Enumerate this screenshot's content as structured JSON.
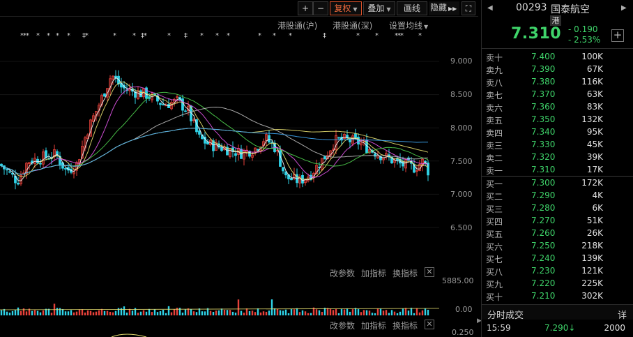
{
  "toolbar": {
    "plus": "+",
    "minus": "−",
    "fuquan": "复权",
    "diejia": "叠加",
    "huaxian": "画线",
    "yincang": "隐藏",
    "expand": "⛶"
  },
  "sub_toolbar": {
    "hk_connect_sh": "港股通(沪)",
    "hk_connect_sz": "港股通(深)",
    "ma_settings": "设置均线"
  },
  "main_axis": [
    "9.000",
    "8.500",
    "8.000",
    "7.500",
    "7.000",
    "6.500"
  ],
  "panel_links": {
    "change_params": "改参数",
    "add_indicator": "加指标",
    "swap_indicator": "换指标",
    "close": "✕"
  },
  "volume_axis": [
    "5885.00",
    "0.00"
  ],
  "lower_axis": [
    "0.250"
  ],
  "quote": {
    "code": "00293",
    "name": "国泰航空",
    "market_badge": "港",
    "price": "7.310",
    "change": "- 0.190",
    "change_pct": "- 2.53%",
    "add": "+"
  },
  "order_book": {
    "asks": [
      {
        "label": "卖十",
        "price": "7.400",
        "volume": "100K"
      },
      {
        "label": "卖九",
        "price": "7.390",
        "volume": "67K"
      },
      {
        "label": "卖八",
        "price": "7.380",
        "volume": "116K"
      },
      {
        "label": "卖七",
        "price": "7.370",
        "volume": "63K"
      },
      {
        "label": "卖六",
        "price": "7.360",
        "volume": "83K"
      },
      {
        "label": "卖五",
        "price": "7.350",
        "volume": "132K"
      },
      {
        "label": "卖四",
        "price": "7.340",
        "volume": "95K"
      },
      {
        "label": "卖三",
        "price": "7.330",
        "volume": "45K"
      },
      {
        "label": "卖二",
        "price": "7.320",
        "volume": "39K"
      },
      {
        "label": "卖一",
        "price": "7.310",
        "volume": "17K"
      }
    ],
    "bids": [
      {
        "label": "买一",
        "price": "7.300",
        "volume": "172K"
      },
      {
        "label": "买二",
        "price": "7.290",
        "volume": "4K"
      },
      {
        "label": "买三",
        "price": "7.280",
        "volume": "6K"
      },
      {
        "label": "买四",
        "price": "7.270",
        "volume": "51K"
      },
      {
        "label": "买五",
        "price": "7.260",
        "volume": "26K"
      },
      {
        "label": "买六",
        "price": "7.250",
        "volume": "218K"
      },
      {
        "label": "买七",
        "price": "7.240",
        "volume": "139K"
      },
      {
        "label": "买八",
        "price": "7.230",
        "volume": "121K"
      },
      {
        "label": "买九",
        "price": "7.220",
        "volume": "225K"
      },
      {
        "label": "买十",
        "price": "7.210",
        "volume": "302K"
      }
    ]
  },
  "ticks": {
    "title": "分时成交",
    "more": "详",
    "last": {
      "time": "15:59",
      "price": "7.290",
      "direction": "↓",
      "volume": "2000"
    }
  },
  "colors": {
    "up": "#e8413a",
    "down": "#2fd3e8",
    "green_quote": "#3fd46a",
    "accent": "#f06a3c"
  }
}
